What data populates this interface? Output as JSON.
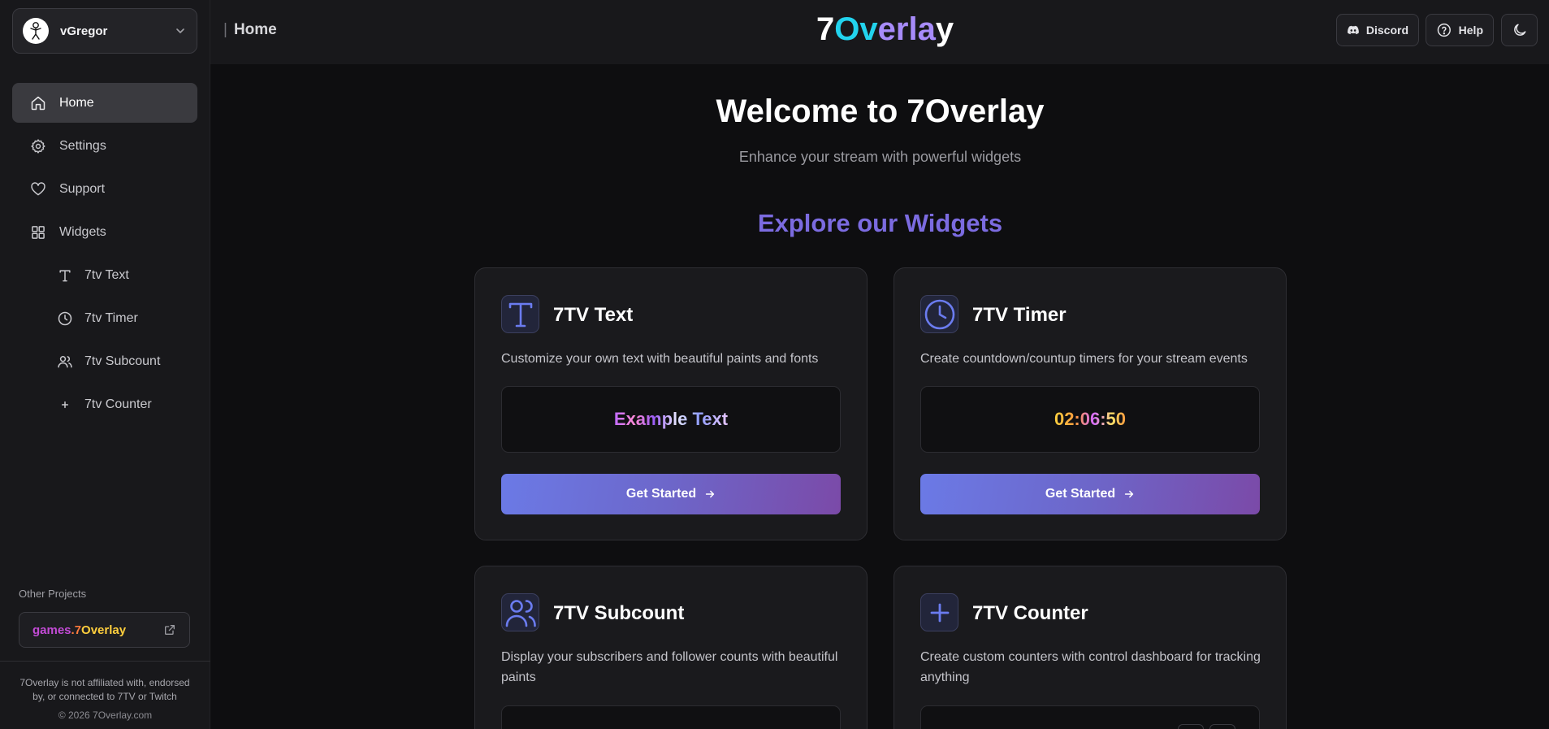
{
  "header": {
    "breadcrumb": "Home",
    "brand": [
      "7",
      "O",
      "v",
      "e",
      "r",
      "l",
      "a",
      "y"
    ],
    "discord_label": "Discord",
    "help_label": "Help"
  },
  "user": {
    "name": "vGregor"
  },
  "sidebar": {
    "items": [
      {
        "label": "Home",
        "icon": "home-icon"
      },
      {
        "label": "Settings",
        "icon": "gear-icon"
      },
      {
        "label": "Support",
        "icon": "heart-icon"
      },
      {
        "label": "Widgets",
        "icon": "grid-icon"
      }
    ],
    "sub_items": [
      {
        "label": "7tv Text",
        "icon": "text-icon"
      },
      {
        "label": "7tv Timer",
        "icon": "clock-icon"
      },
      {
        "label": "7tv Subcount",
        "icon": "users-icon"
      },
      {
        "label": "7tv Counter",
        "icon": "plus-icon"
      }
    ],
    "other_projects_title": "Other Projects",
    "games_link": [
      "games",
      ".7",
      "Overlay"
    ],
    "disclaimer": "7Overlay is not affiliated with, endorsed by, or connected to 7TV or Twitch",
    "copyright": "© 2026 7Overlay.com"
  },
  "main": {
    "welcome": "Welcome to 7Overlay",
    "tagline": "Enhance your stream with powerful widgets",
    "explore": "Explore our Widgets",
    "cards": [
      {
        "title": "7TV Text",
        "icon": "text-icon",
        "description": "Customize your own text with beautiful paints and fonts",
        "preview": "Example Text",
        "button": "Get Started"
      },
      {
        "title": "7TV Timer",
        "icon": "clock-icon",
        "description": "Create countdown/countup timers for your stream events",
        "preview": "02:06:50",
        "button": "Get Started"
      },
      {
        "title": "7TV Subcount",
        "icon": "users-icon",
        "description": "Display your subscribers and follower counts with beautiful paints"
      },
      {
        "title": "7TV Counter",
        "icon": "plus-icon",
        "description": "Create custom counters with control dashboard for tracking anything"
      }
    ]
  },
  "colors": {
    "accent": "#7b6be0",
    "brand_cyan": "#22d3ee",
    "brand_purple": "#a78bfa",
    "button_gradient_start": "#6b7ae6",
    "button_gradient_end": "#7b4aa8"
  }
}
